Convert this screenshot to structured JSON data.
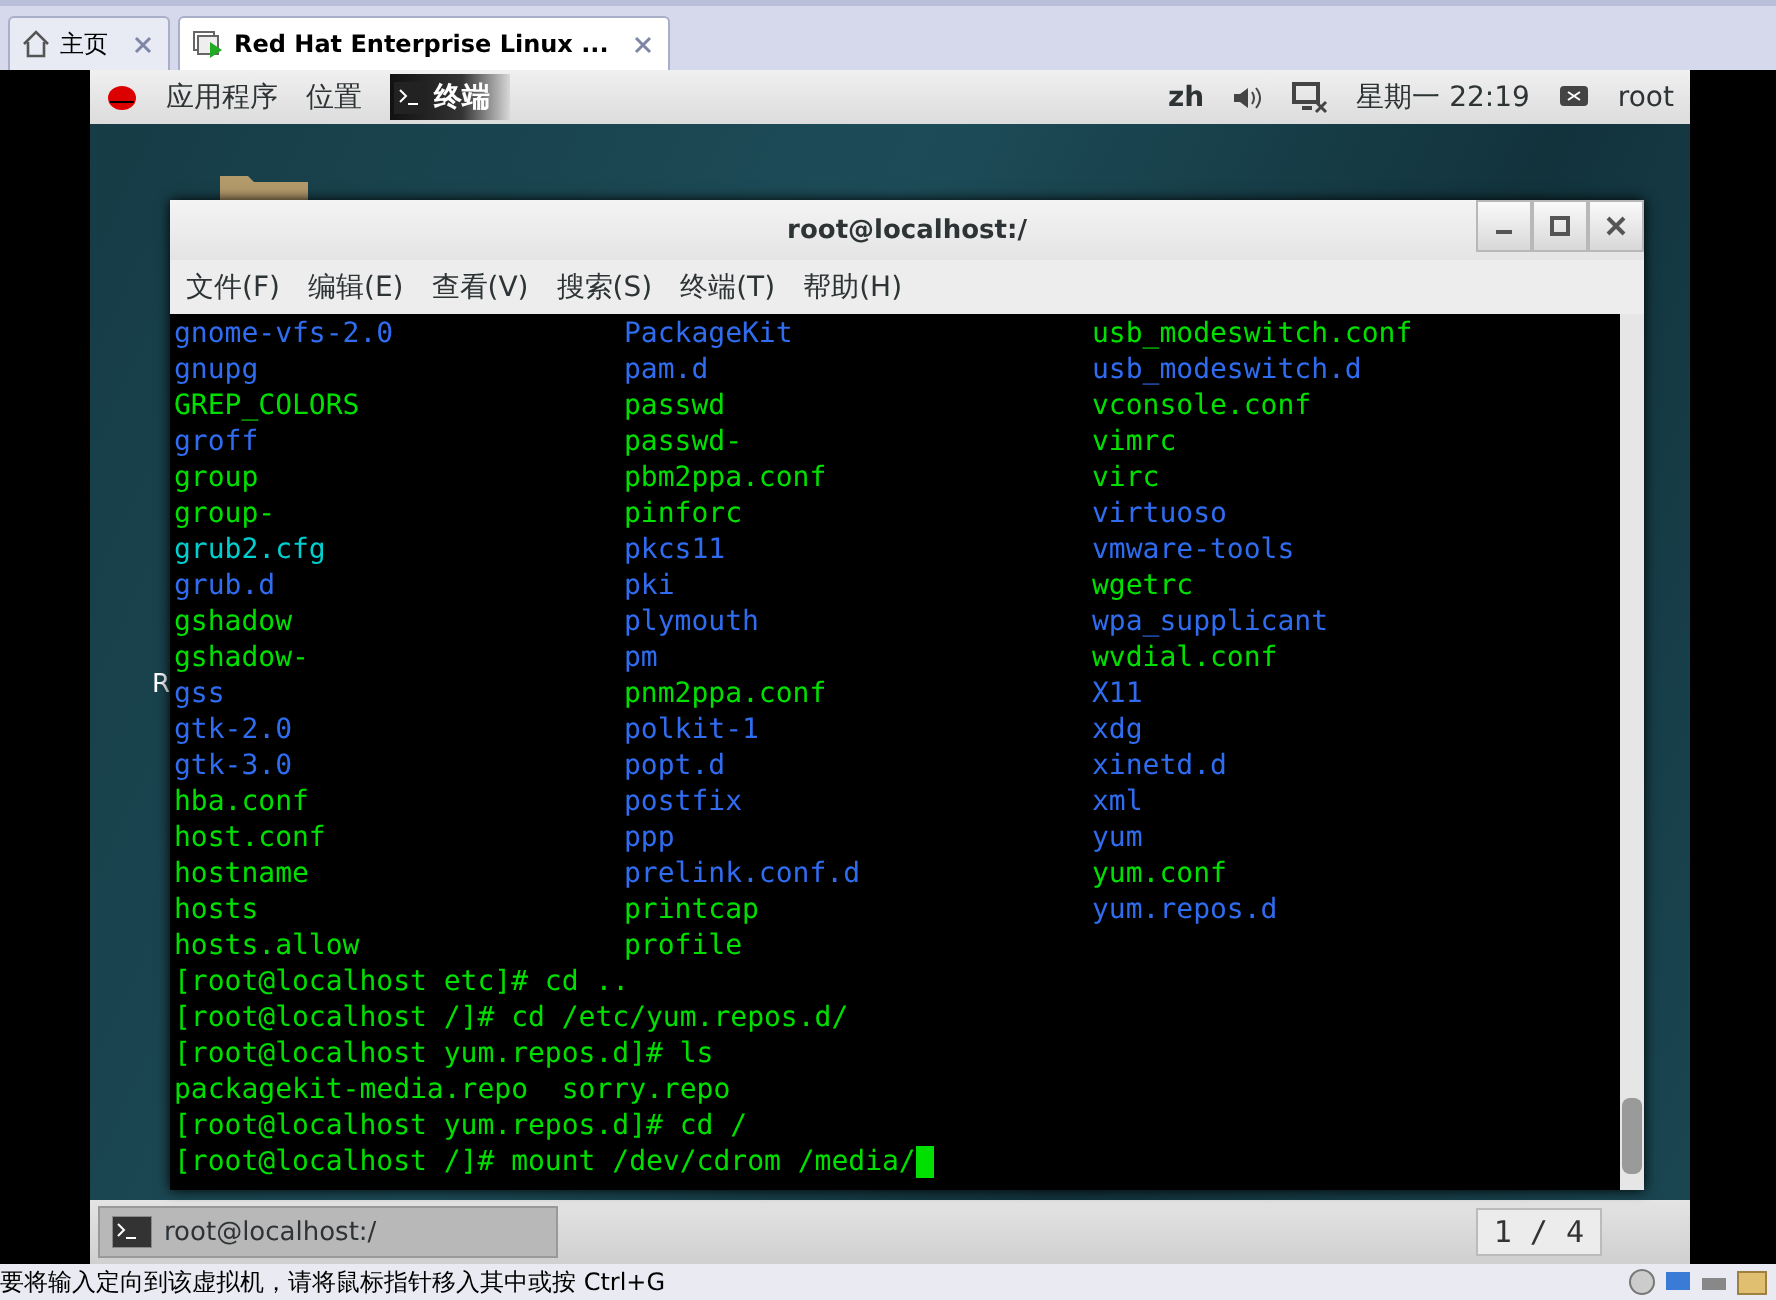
{
  "host_tabs": [
    {
      "label": "主页",
      "selected": false
    },
    {
      "label": "Red Hat Enterprise Linux ...",
      "selected": true
    }
  ],
  "guest_topbar": {
    "applications": "应用程序",
    "places": "位置",
    "active_app": "终端",
    "input_method": "zh",
    "clock": "星期一 22:19",
    "user": "root"
  },
  "desktop": {
    "partial_label": "R"
  },
  "terminal": {
    "title": "root@localhost:/",
    "menu": [
      "文件(F)",
      "编辑(E)",
      "查看(V)",
      "搜索(S)",
      "终端(T)",
      "帮助(H)"
    ],
    "listing": [
      [
        {
          "name": "gnome-vfs-2.0",
          "kind": "dir"
        },
        {
          "name": "gnupg",
          "kind": "dir"
        },
        {
          "name": "GREP_COLORS",
          "kind": "file"
        },
        {
          "name": "groff",
          "kind": "dir"
        },
        {
          "name": "group",
          "kind": "file"
        },
        {
          "name": "group-",
          "kind": "file"
        },
        {
          "name": "grub2.cfg",
          "kind": "link"
        },
        {
          "name": "grub.d",
          "kind": "dir"
        },
        {
          "name": "gshadow",
          "kind": "file"
        },
        {
          "name": "gshadow-",
          "kind": "file"
        },
        {
          "name": "gss",
          "kind": "dir"
        },
        {
          "name": "gtk-2.0",
          "kind": "dir"
        },
        {
          "name": "gtk-3.0",
          "kind": "dir"
        },
        {
          "name": "hba.conf",
          "kind": "file"
        },
        {
          "name": "host.conf",
          "kind": "file"
        },
        {
          "name": "hostname",
          "kind": "file"
        },
        {
          "name": "hosts",
          "kind": "file"
        },
        {
          "name": "hosts.allow",
          "kind": "file"
        }
      ],
      [
        {
          "name": "PackageKit",
          "kind": "dir"
        },
        {
          "name": "pam.d",
          "kind": "dir"
        },
        {
          "name": "passwd",
          "kind": "file"
        },
        {
          "name": "passwd-",
          "kind": "file"
        },
        {
          "name": "pbm2ppa.conf",
          "kind": "file"
        },
        {
          "name": "pinforc",
          "kind": "file"
        },
        {
          "name": "pkcs11",
          "kind": "dir"
        },
        {
          "name": "pki",
          "kind": "dir"
        },
        {
          "name": "plymouth",
          "kind": "dir"
        },
        {
          "name": "pm",
          "kind": "dir"
        },
        {
          "name": "pnm2ppa.conf",
          "kind": "file"
        },
        {
          "name": "polkit-1",
          "kind": "dir"
        },
        {
          "name": "popt.d",
          "kind": "dir"
        },
        {
          "name": "postfix",
          "kind": "dir"
        },
        {
          "name": "ppp",
          "kind": "dir"
        },
        {
          "name": "prelink.conf.d",
          "kind": "dir"
        },
        {
          "name": "printcap",
          "kind": "file"
        },
        {
          "name": "profile",
          "kind": "file"
        }
      ],
      [
        {
          "name": "usb_modeswitch.conf",
          "kind": "file"
        },
        {
          "name": "usb_modeswitch.d",
          "kind": "dir"
        },
        {
          "name": "vconsole.conf",
          "kind": "file"
        },
        {
          "name": "vimrc",
          "kind": "file"
        },
        {
          "name": "virc",
          "kind": "file"
        },
        {
          "name": "virtuoso",
          "kind": "dir"
        },
        {
          "name": "vmware-tools",
          "kind": "dir"
        },
        {
          "name": "wgetrc",
          "kind": "file"
        },
        {
          "name": "wpa_supplicant",
          "kind": "dir"
        },
        {
          "name": "wvdial.conf",
          "kind": "file"
        },
        {
          "name": "X11",
          "kind": "dir"
        },
        {
          "name": "xdg",
          "kind": "dir"
        },
        {
          "name": "xinetd.d",
          "kind": "dir"
        },
        {
          "name": "xml",
          "kind": "dir"
        },
        {
          "name": "yum",
          "kind": "dir"
        },
        {
          "name": "yum.conf",
          "kind": "file"
        },
        {
          "name": "yum.repos.d",
          "kind": "dir"
        }
      ]
    ],
    "lines": [
      "[root@localhost etc]# cd ..",
      "[root@localhost /]# cd /etc/yum.repos.d/",
      "[root@localhost yum.repos.d]# ls",
      "packagekit-media.repo  sorry.repo",
      "[root@localhost yum.repos.d]# cd /",
      "[root@localhost /]# mount /dev/cdrom /media/"
    ]
  },
  "taskbar": {
    "window_button": "root@localhost:/",
    "workspace": "1 / 4"
  },
  "status_bar": {
    "message": "要将输入定向到该虚拟机，请将鼠标指针移入其中或按 Ctrl+G"
  }
}
